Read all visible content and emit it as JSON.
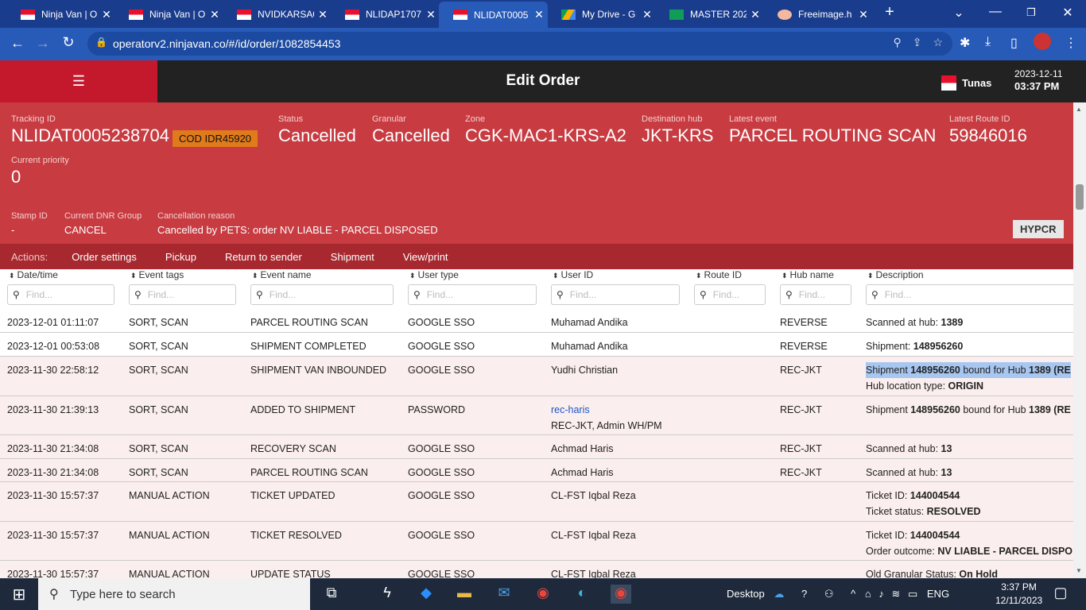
{
  "browser": {
    "tabs": [
      {
        "title": "Ninja Van | O",
        "active": false
      },
      {
        "title": "Ninja Van | O",
        "active": false
      },
      {
        "title": "NVIDKARSA0",
        "active": false
      },
      {
        "title": "NLIDAP1707",
        "active": false
      },
      {
        "title": "NLIDAT0005",
        "active": true
      },
      {
        "title": "My Drive - G",
        "active": false
      },
      {
        "title": "MASTER 202",
        "active": false
      },
      {
        "title": "Freeimage.h",
        "active": false
      }
    ],
    "url": "operatorv2.ninjavan.co/#/id/order/1082854453"
  },
  "header": {
    "title": "Edit Order",
    "country": "Tunas",
    "date": "2023-12-11",
    "time": "03:37 PM"
  },
  "summary": {
    "tracking_label": "Tracking ID",
    "tracking_id": "NLIDAT0005238704",
    "cod_badge": "COD IDR45920",
    "status_label": "Status",
    "status": "Cancelled",
    "granular_label": "Granular",
    "granular": "Cancelled",
    "zone_label": "Zone",
    "zone": "CGK-MAC1-KRS-A2",
    "dest_hub_label": "Destination hub",
    "dest_hub": "JKT-KRS",
    "latest_event_label": "Latest event",
    "latest_event": "PARCEL ROUTING SCAN",
    "latest_route_label": "Latest Route ID",
    "latest_route": "59846016",
    "priority_label": "Current priority",
    "priority": "0",
    "stamp_label": "Stamp ID",
    "stamp": "-",
    "dnr_label": "Current DNR Group",
    "dnr": "CANCEL",
    "cancel_label": "Cancellation reason",
    "cancel_reason": "Cancelled by PETS: order NV LIABLE - PARCEL DISPOSED",
    "hub_badge": "HYPCR"
  },
  "actions": {
    "label": "Actions:",
    "items": [
      "Order settings",
      "Pickup",
      "Return to sender",
      "Shipment",
      "View/print"
    ]
  },
  "table": {
    "columns": [
      "Date/time",
      "Event tags",
      "Event name",
      "User type",
      "User ID",
      "Route ID",
      "Hub name",
      "Description"
    ],
    "filter_placeholder": "Find...",
    "rows": [
      {
        "dt": "2023-12-01 01:11:07",
        "tags": "SORT, SCAN",
        "name": "PARCEL ROUTING SCAN",
        "utype": "GOOGLE SSO",
        "uid": "Muhamad Andika",
        "route": "",
        "hub": "REVERSE",
        "d1a": "Scanned at hub: ",
        "d1b": "1389"
      },
      {
        "dt": "2023-12-01 00:53:08",
        "tags": "SORT, SCAN",
        "name": "SHIPMENT COMPLETED",
        "utype": "GOOGLE SSO",
        "uid": "Muhamad Andika",
        "route": "",
        "hub": "REVERSE",
        "d1a": "Shipment: ",
        "d1b": "148956260"
      },
      {
        "dt": "2023-11-30 22:58:12",
        "tags": "SORT, SCAN",
        "name": "SHIPMENT VAN INBOUNDED",
        "utype": "GOOGLE SSO",
        "uid": "Yudhi Christian",
        "route": "",
        "hub": "REC-JKT",
        "d1a": "Shipment ",
        "d1b": "148956260",
        "d1c": " bound for Hub ",
        "d1d": "1389 (RE",
        "d2a": "Hub location type: ",
        "d2b": "ORIGIN"
      },
      {
        "dt": "2023-11-30 21:39:13",
        "tags": "SORT, SCAN",
        "name": "ADDED TO SHIPMENT",
        "utype": "PASSWORD",
        "uid": "rec-haris",
        "uid2": "REC-JKT, Admin WH/PM",
        "route": "",
        "hub": "REC-JKT",
        "d1a": "Shipment ",
        "d1b": "148956260",
        "d1c": " bound for Hub ",
        "d1d": "1389 (RE"
      },
      {
        "dt": "2023-11-30 21:34:08",
        "tags": "SORT, SCAN",
        "name": "RECOVERY SCAN",
        "utype": "GOOGLE SSO",
        "uid": "Achmad Haris",
        "route": "",
        "hub": "REC-JKT",
        "d1a": "Scanned at hub: ",
        "d1b": "13"
      },
      {
        "dt": "2023-11-30 21:34:08",
        "tags": "SORT, SCAN",
        "name": "PARCEL ROUTING SCAN",
        "utype": "GOOGLE SSO",
        "uid": "Achmad Haris",
        "route": "",
        "hub": "REC-JKT",
        "d1a": "Scanned at hub: ",
        "d1b": "13"
      },
      {
        "dt": "2023-11-30 15:57:37",
        "tags": "MANUAL ACTION",
        "name": "TICKET UPDATED",
        "utype": "GOOGLE SSO",
        "uid": "CL-FST Iqbal Reza",
        "route": "",
        "hub": "",
        "d1a": "Ticket ID: ",
        "d1b": "144004544",
        "d2a": "Ticket status: ",
        "d2b": "RESOLVED"
      },
      {
        "dt": "2023-11-30 15:57:37",
        "tags": "MANUAL ACTION",
        "name": "TICKET RESOLVED",
        "utype": "GOOGLE SSO",
        "uid": "CL-FST Iqbal Reza",
        "route": "",
        "hub": "",
        "d1a": "Ticket ID: ",
        "d1b": "144004544",
        "d2a": "Order outcome: ",
        "d2b": "NV LIABLE - PARCEL DISPO"
      },
      {
        "dt": "2023-11-30 15:57:37",
        "tags": "MANUAL ACTION",
        "name": "UPDATE STATUS",
        "utype": "GOOGLE SSO",
        "uid": "CL-FST Iqbal Reza",
        "route": "",
        "hub": "",
        "d1a": "Old Granular Status: ",
        "d1b": "On Hold"
      }
    ]
  },
  "taskbar": {
    "search_placeholder": "Type here to search",
    "desktop_label": "Desktop",
    "lang": "ENG",
    "time": "3:37 PM",
    "date": "12/11/2023"
  },
  "colors": {
    "summary_bg": "#c73b41",
    "actions_bg": "#a7282f",
    "menu_bg": "#c4192c",
    "cod_badge": "#e07b1b",
    "chrome_tab": "#1a3c8c"
  }
}
